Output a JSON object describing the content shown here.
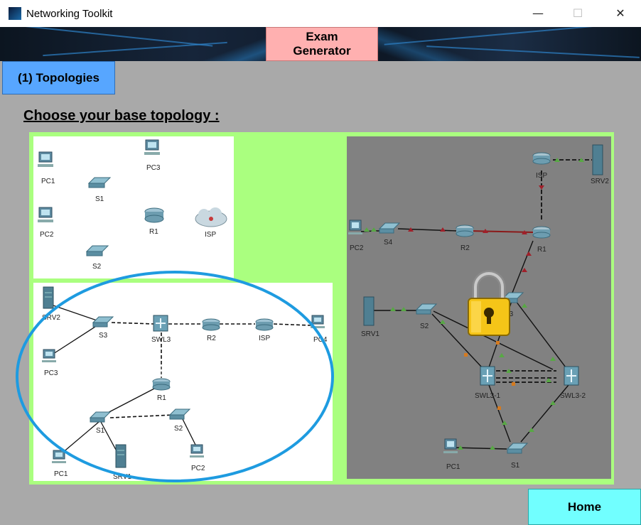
{
  "window": {
    "title": "Networking Toolkit",
    "minimize": "—",
    "maximize": "☐",
    "close": "✕"
  },
  "tabs": {
    "exam_generator": "Exam\nGenerator",
    "topologies": "(1) Topologies"
  },
  "heading": "Choose your base topology :",
  "home_button": "Home",
  "colors": {
    "exam_tab": "#ffb0b0",
    "topologies_tab": "#57a6ff",
    "home_button": "#71ffff",
    "frame_green": "#aaff7f",
    "selection_ellipse": "#1e9be0",
    "lock": "#f5c518"
  },
  "topology_1": {
    "devices": [
      "PC1",
      "PC3",
      "S1",
      "PC2",
      "R1",
      "ISP",
      "S2"
    ]
  },
  "topology_2": {
    "devices": [
      "SRV2",
      "S3",
      "SWL3",
      "R2",
      "ISP",
      "PC4",
      "PC3",
      "R1",
      "S1",
      "S2",
      "PC1",
      "SRV1",
      "PC2"
    ]
  },
  "topology_3": {
    "locked": true,
    "devices": [
      "ISP",
      "SRV2",
      "PC2",
      "S4",
      "R2",
      "R1",
      "SRV1",
      "S2",
      "S3",
      "SWL3-1",
      "SWL3-2",
      "PC1",
      "S1"
    ]
  }
}
